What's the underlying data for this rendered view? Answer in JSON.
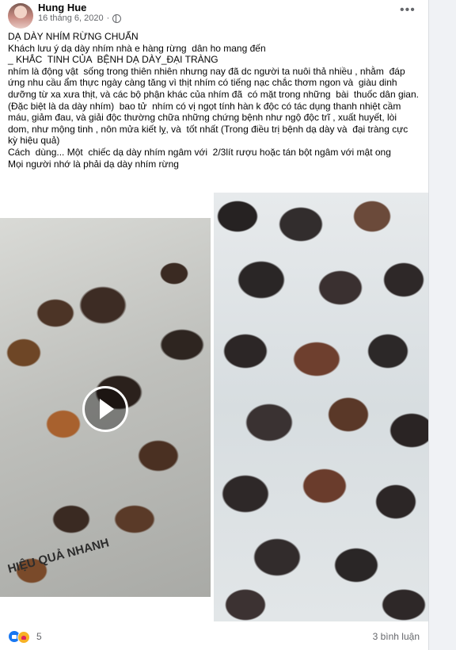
{
  "post": {
    "author": "Hung Hue",
    "date": "16 tháng 6, 2020",
    "privacy_icon": "globe-icon",
    "more_icon": "more-options-icon",
    "text_lines": [
      "DẠ DÀY NHÍM RỪNG CHUẨN",
      "Khách lưu ý dạ dày nhím nhà e hàng rừng  dân ho mang đến",
      "_ KHẮC  TINH CỦA  BỆNH DẠ DÀY_ĐẠI TRÀNG",
      "nhím là động vật  sống trong thiên nhiên nhưng nay đã dc người ta nuôi thả nhiều , nhằm  đáp ứng nhu cầu ẩm thực ngày càng tăng vì thịt nhím có tiếng nạc chắc thơm ngon và  giàu dinh dưỡng từ xa xưa thịt, và các bộ phận khác của nhím đã  có mặt trong những  bài  thuốc dân gian.",
      "(Đặc biệt là da dày nhím)  bao tử  nhím có vị ngọt tính hàn k độc có tác dụng thanh nhiệt cầm máu, giảm đau, và giải độc thường chữa những chứng bệnh như ngộ độc trĩ , xuất huyết, lòi dom, như mộng tinh , nôn mửa kiết lỵ, và  tốt nhất (Trong điều trị bệnh dạ dày và  đại tràng cực kỳ hiệu quả)",
      "Cách  dùng... Một  chiếc dạ dày nhím ngâm với  2/3lít rượu hoặc tán bột ngâm với mật ong",
      "Mọi người nhớ là phải dạ dày nhím rừng"
    ]
  },
  "media": {
    "video_play_icon": "play-icon",
    "newspaper_text": "HIỆU QUẢ NHANH"
  },
  "footer": {
    "reactions": [
      "like-icon",
      "love-icon"
    ],
    "reaction_count": "5",
    "comments": "3 bình luận"
  }
}
